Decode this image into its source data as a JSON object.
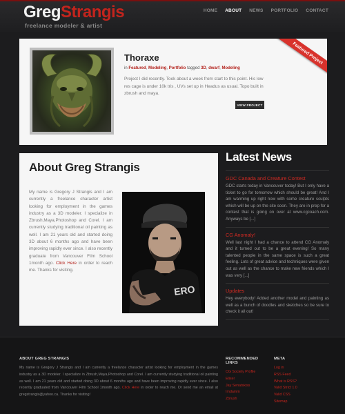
{
  "header": {
    "logo_first": "Greg",
    "logo_last": "Strangis",
    "tagline": "freelance modeler & artist",
    "nav": [
      "HOME",
      "ABOUT",
      "NEWS",
      "PORTFOLIO",
      "CONTACT"
    ],
    "active_nav": "ABOUT"
  },
  "featured": {
    "ribbon": "Featured Project",
    "title": "Thoraxe",
    "meta_in": "in",
    "categories": [
      "Featured",
      "Modeling",
      "Portfolio"
    ],
    "meta_tagged": "tagged",
    "tags": [
      "3D",
      "dwarf",
      "Modeling"
    ],
    "description": "Project I did recently. Took about a week from start to this point. His low res cage is under 10k tris , UVs set up in Headus as usual. Topo built in zbrush and maya.",
    "button_label": "VIEW PROJECT"
  },
  "about": {
    "title": "About Greg Strangis",
    "text": "My name is Gregory J Strangis and I am currently a freelance character artist looking for employment in the games industry as a 3D modeler. I specialize in Zbrush,Maya,Photoshop and Corel. I am currently studying traditional oil painting as well. I am 21 years old and started doing 3D about 6 months ago and have been improving rapidly ever since. I also recently graduate from Vancouver Film School 1month ago.",
    "link_text": "Click Here",
    "after_link": "in order to reach me. Thanks for visiting."
  },
  "news": {
    "heading": "Latest News",
    "items": [
      {
        "title": "GDC Canada and Creature Contest",
        "body": "GDC starts today in Vancouver today! But I only have a ticket to go for tomorrow which should be great! And I am warming up right now with some creature sculpts which will be up on the site soon. They are in prep for a contest that is going on over at www.cgcoach.com. Anyways be [...]"
      },
      {
        "title": "CG Anomaly!",
        "body": "Well last night I had a chance to attend CG Anomaly and it turned out to be a great evening! So many talented people in the same space is such a great feeling. Lots of great advice and techniques were given out as well as the chance to make new friends which I was very [...]"
      },
      {
        "title": "Updates",
        "body": "Hey everybody! Added another model and painting as well as a bunch of doodles and sketches so be sure to check it all out!"
      }
    ]
  },
  "footer": {
    "about_heading": "ABOUT GREG STRANGIS",
    "about_text": "My name is Gregory J Strangis and I am currently a freelance character artist looking for employment in the games industry as a 3D modeler. I specialize in Zbrush,Maya,Photoshop and Corel. I am currently studying traditional oil painting as well. I am 21 years old and started doing 3D about 6 months ago and have been improving rapidly ever since. I also recently graduated from Vancouver Film School 1month ago.",
    "about_link": "Click Here",
    "about_after": "in order to reach me. Or send me an email at gregstrangis@yahoo.ca.  Thanks for visiting!",
    "links_heading": "RECOMMENDED LINKS",
    "links": [
      "CG Society Profile",
      "Elixer",
      "Jay Senatskiss",
      "Imdamm",
      "Zbrush"
    ],
    "meta_heading": "META",
    "meta": [
      "Log in",
      "RSS Feed",
      "What is RSS?",
      "Valid Strict 1.0",
      "Valid CSS",
      "Sitemap"
    ]
  },
  "colors": {
    "accent": "#c3241d",
    "background": "#1c1c1e",
    "panel": "#f6f6f6"
  }
}
